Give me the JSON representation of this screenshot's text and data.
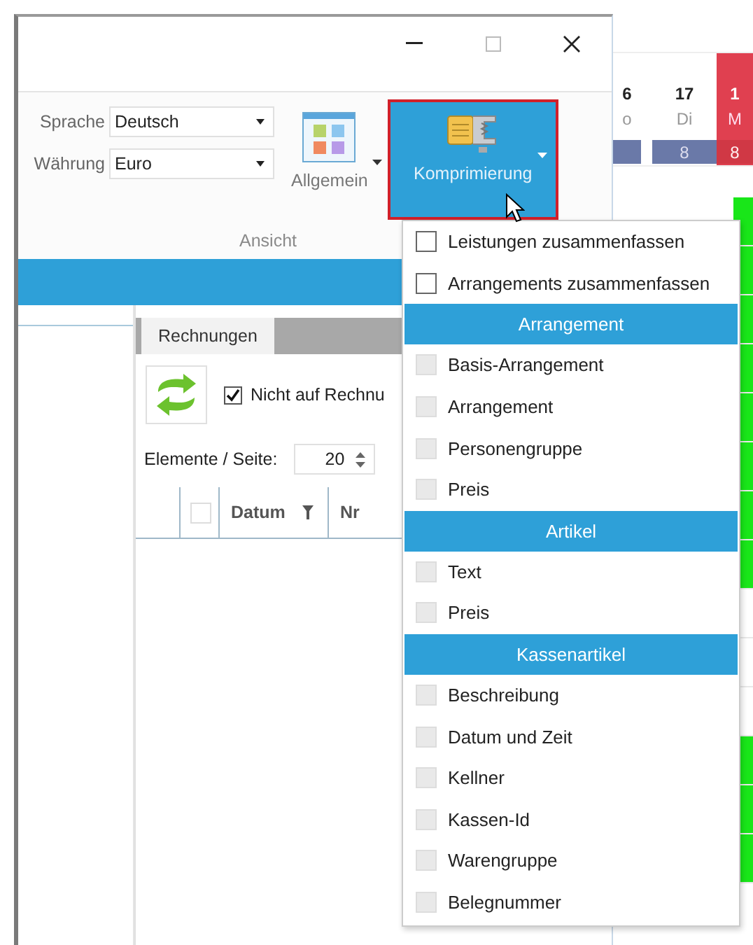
{
  "window": {
    "controls": [
      {
        "kind": "minimize"
      },
      {
        "kind": "maximize"
      },
      {
        "kind": "close"
      }
    ]
  },
  "ribbon": {
    "fields": [
      {
        "label": "Sprache",
        "value": "Deutsch"
      },
      {
        "label": "Währung",
        "value": "Euro"
      }
    ],
    "buttons": [
      {
        "kind": "layout",
        "label": "Allgemein",
        "selected": false
      },
      {
        "kind": "compress",
        "label": "Komprimierung",
        "selected": true
      }
    ],
    "group_label": "Ansicht"
  },
  "tabs": [
    {
      "label": "Rechnungen",
      "selected": true
    }
  ],
  "toolbar": {
    "filter_checkbox": {
      "label": "Nicht auf Rechnu",
      "checked": true
    },
    "page_size_label": "Elemente / Seite:",
    "page_size": "20"
  },
  "table": {
    "columns": [
      {
        "kind": "blank"
      },
      {
        "kind": "check",
        "checked": false
      },
      {
        "kind": "text",
        "label": "Datum",
        "filter": true
      },
      {
        "kind": "text",
        "label": "Nr",
        "filter": false
      }
    ]
  },
  "calendar": {
    "days": [
      {
        "kind": "normal",
        "number": "6",
        "weekday": "o"
      },
      {
        "kind": "normal",
        "number": "17",
        "weekday": "Di",
        "count": "8"
      },
      {
        "kind": "holiday",
        "number": "1",
        "weekday": "M",
        "count": "8"
      }
    ],
    "rows": [
      {
        "booked": true
      },
      {
        "booked": true
      },
      {
        "booked": true
      },
      {
        "booked": true
      },
      {
        "booked": true
      },
      {
        "booked": true
      },
      {
        "booked": true
      },
      {
        "booked": true
      },
      {
        "booked": false
      },
      {
        "booked": false
      },
      {
        "booked": false
      },
      {
        "booked": true
      },
      {
        "booked": true
      },
      {
        "booked": true
      }
    ]
  },
  "menu": {
    "items": [
      {
        "kind": "check",
        "label": "Leistungen zusammenfassen",
        "checked": false,
        "disabled": false
      },
      {
        "kind": "check",
        "label": "Arrangements zusammenfassen",
        "checked": false,
        "disabled": false
      },
      {
        "kind": "header",
        "label": "Arrangement"
      },
      {
        "kind": "check",
        "label": "Basis-Arrangement",
        "checked": false,
        "disabled": true
      },
      {
        "kind": "check",
        "label": "Arrangement",
        "checked": false,
        "disabled": true
      },
      {
        "kind": "check",
        "label": "Personengruppe",
        "checked": false,
        "disabled": true
      },
      {
        "kind": "check",
        "label": "Preis",
        "checked": false,
        "disabled": true
      },
      {
        "kind": "header",
        "label": "Artikel"
      },
      {
        "kind": "check",
        "label": "Text",
        "checked": false,
        "disabled": true
      },
      {
        "kind": "check",
        "label": "Preis",
        "checked": false,
        "disabled": true
      },
      {
        "kind": "header",
        "label": "Kassenartikel"
      },
      {
        "kind": "check",
        "label": "Beschreibung",
        "checked": false,
        "disabled": true
      },
      {
        "kind": "check",
        "label": "Datum und Zeit",
        "checked": false,
        "disabled": true
      },
      {
        "kind": "check",
        "label": "Kellner",
        "checked": false,
        "disabled": true
      },
      {
        "kind": "check",
        "label": "Kassen-Id",
        "checked": false,
        "disabled": true
      },
      {
        "kind": "check",
        "label": "Warengruppe",
        "checked": false,
        "disabled": true
      },
      {
        "kind": "check",
        "label": "Belegnummer",
        "checked": false,
        "disabled": true
      }
    ]
  }
}
